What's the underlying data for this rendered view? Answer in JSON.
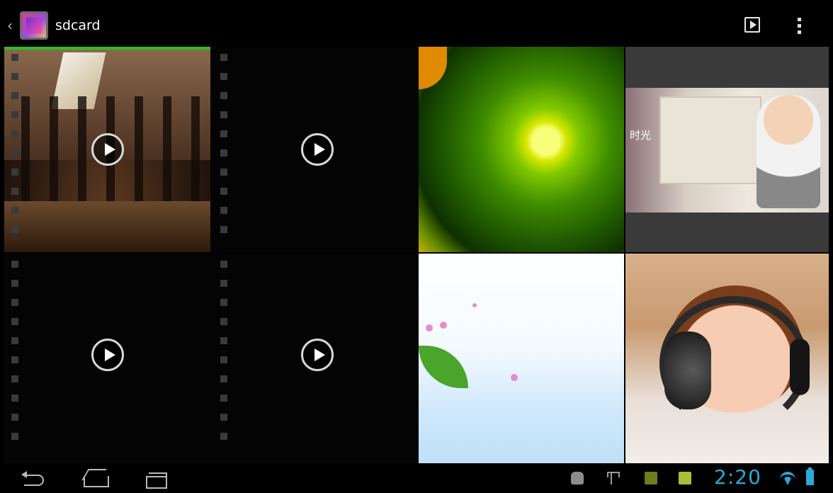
{
  "actionbar": {
    "title": "sdcard",
    "up_icon": "chevron-left-icon",
    "app_icon": "gallery-app-icon",
    "actions": [
      {
        "name": "slideshow",
        "icon": "slideshow-icon"
      },
      {
        "name": "overflow-menu",
        "icon": "overflow-menu-icon"
      }
    ]
  },
  "grid": {
    "items": [
      {
        "type": "video",
        "thumb": "dance-party-scene",
        "play_icon": "play-icon",
        "selected": true
      },
      {
        "type": "video",
        "thumb": "dark-frame",
        "play_icon": "play-icon"
      },
      {
        "type": "image",
        "thumb": "kiwi-slice"
      },
      {
        "type": "image",
        "thumb": "baby-portrait",
        "caption": "时光"
      },
      {
        "type": "video",
        "thumb": "dark-frame",
        "play_icon": "play-icon"
      },
      {
        "type": "video",
        "thumb": "dark-frame",
        "play_icon": "play-icon"
      },
      {
        "type": "image",
        "thumb": "illustrated-sky"
      },
      {
        "type": "image",
        "thumb": "baby-with-headphones"
      }
    ]
  },
  "navbar": {
    "buttons": [
      "back-icon",
      "home-icon",
      "recent-apps-icon"
    ]
  },
  "statusbar": {
    "notifications": [
      "android-debug-icon",
      "usb-icon",
      "notification-app-icon",
      "notification-check-icon"
    ],
    "time": "2:20",
    "wifi": "wifi-icon",
    "battery": "battery-icon",
    "accent_color": "#2ca8d9"
  }
}
